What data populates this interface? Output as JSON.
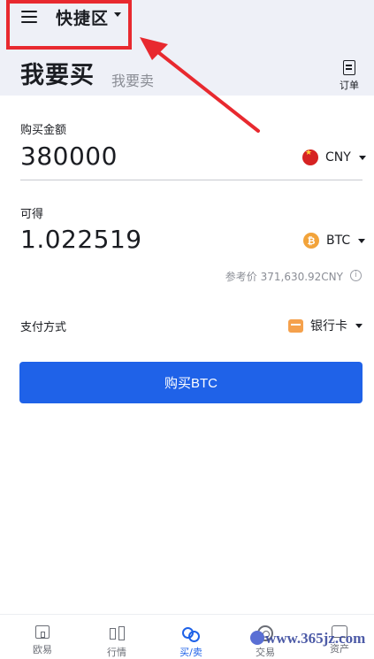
{
  "topbar": {
    "title": "快捷区"
  },
  "tabs": {
    "buy": "我要买",
    "sell": "我要卖",
    "orders": "订单"
  },
  "buy_section": {
    "label": "购买金额",
    "value": "380000",
    "currency": "CNY"
  },
  "receive_section": {
    "label": "可得",
    "value": "1.022519",
    "currency": "BTC",
    "reference": "参考价 371,630.92CNY"
  },
  "payment": {
    "label": "支付方式",
    "method": "银行卡"
  },
  "buy_button": "购买BTC",
  "bottom_nav": [
    {
      "label": "欧易",
      "icon": "home-icon",
      "active": false
    },
    {
      "label": "行情",
      "icon": "candlestick-icon",
      "active": false
    },
    {
      "label": "买/卖",
      "icon": "buy-sell-icon",
      "active": true
    },
    {
      "label": "交易",
      "icon": "exchange-icon",
      "active": false
    },
    {
      "label": "资产",
      "icon": "wallet-icon",
      "active": false
    }
  ],
  "watermark": "www.365jz.com",
  "colors": {
    "accent": "#1f62e8",
    "annotation": "#e8292f",
    "header_bg": "#eef0f7"
  }
}
